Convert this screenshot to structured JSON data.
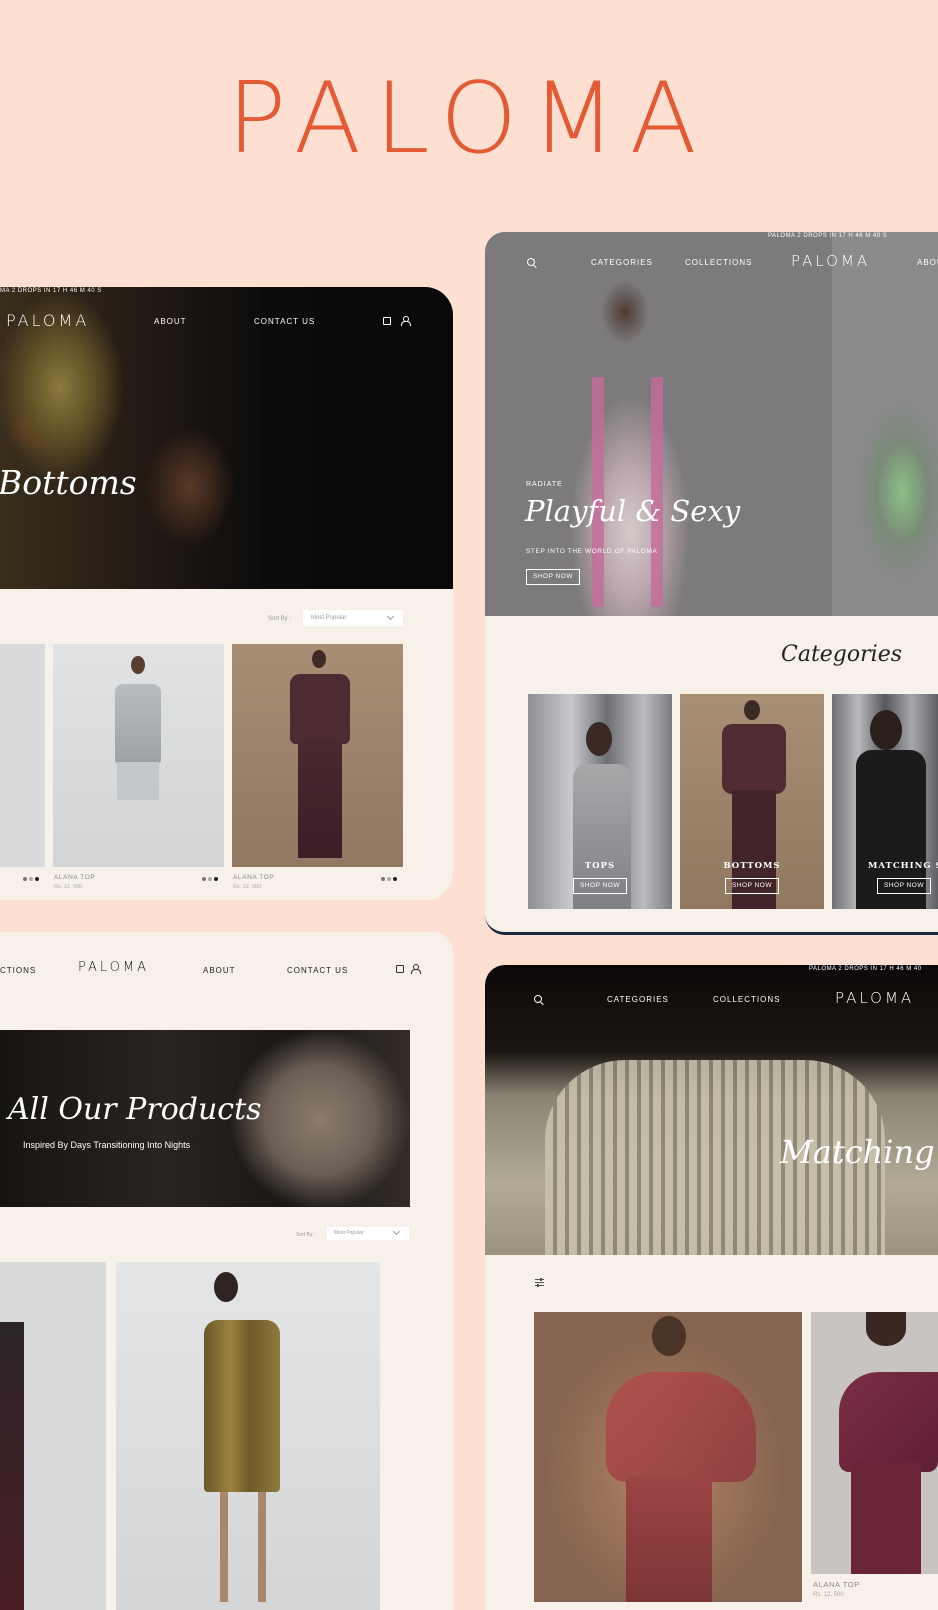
{
  "brand": {
    "name": "PALOMA"
  },
  "card_bottoms": {
    "ticker": "MA 2 DROPS IN    17  H    46  M    40  S",
    "logo": "PALOMA",
    "nav": [
      "ABOUT",
      "CONTACT US"
    ],
    "hero_title": "Bottoms",
    "sort_label": "Sort By :",
    "sort_value": "Most Popular",
    "products": [
      {
        "name": "ALANA TOP",
        "price": "Rs. 12, 500"
      },
      {
        "name": "ALANA TOP",
        "price": "Rs. 12, 500"
      }
    ]
  },
  "card_home": {
    "ticker": "PALOMA 2 DROPS IN    17  H    46  M    40  S",
    "nav": [
      "CATEGORIES",
      "COLLECTIONS",
      "ABOU"
    ],
    "logo": "PALOMA",
    "eyebrow": "RADIATE",
    "hero_title": "Playful & Sexy",
    "hero_sub": "STEP INTO THE WORLD OF PALOMA",
    "hero_cta": "SHOP NOW",
    "section_title": "Categories",
    "categories": [
      {
        "label": "TOPS",
        "cta": "SHOP NOW"
      },
      {
        "label": "BOTTOMS",
        "cta": "SHOP NOW"
      },
      {
        "label": "MATCHING SETS",
        "cta": "SHOP NOW"
      }
    ]
  },
  "card_all": {
    "nav_left": "CTIONS",
    "logo": "PALOMA",
    "nav": [
      "ABOUT",
      "CONTACT US"
    ],
    "hero_title": "All Our Products",
    "hero_sub": "Inspired By Days Transitioning Into Nights",
    "sort_label": "Sort By :",
    "sort_value": "Most Popular"
  },
  "card_sets": {
    "ticker": "PALOMA 2 DROPS IN    17  H    46  M    40",
    "nav": [
      "CATEGORIES",
      "COLLECTIONS"
    ],
    "logo": "PALOMA",
    "hero_title": "Matching S",
    "product": {
      "name": "ALANA TOP",
      "price": "Rs. 12, 500"
    }
  },
  "colors": {
    "brand": "#e35a34",
    "background": "#fde0d1",
    "card": "#f7f1ea"
  }
}
